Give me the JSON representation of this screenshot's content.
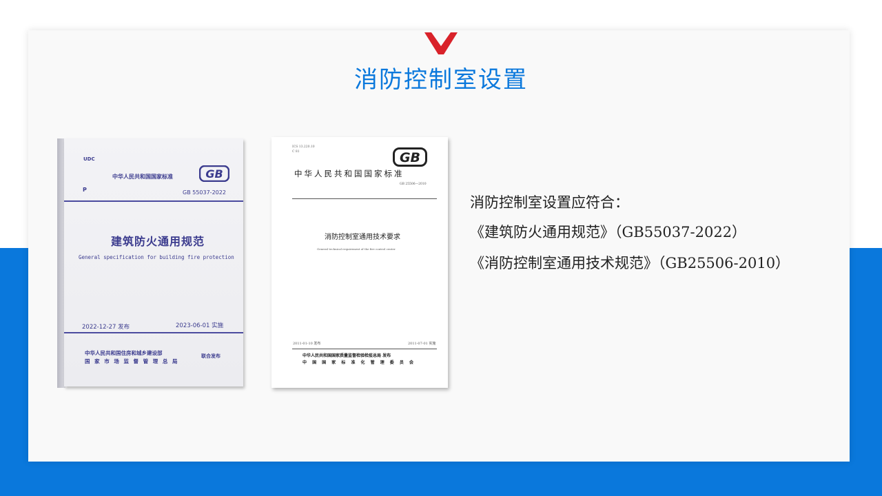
{
  "title": "消防控制室设置",
  "colors": {
    "accent": "#0a78dc",
    "logo_red": "#d9222a"
  },
  "book1": {
    "udc": "UDC",
    "standard_name": "中华人民共和国国家标准",
    "category": "P",
    "code": "GB 55037-2022",
    "title": "建筑防火通用规范",
    "english_title": "General specification for building fire protection",
    "publish_date": "2022-12-27 发布",
    "implement_date": "2023-06-01 实施",
    "dept_line1": "中华人民共和国住房和城乡建设部",
    "dept_line2": "国 家 市 场 监 督 管 理 总 局",
    "joint": "联合发布",
    "logo_text": "GB"
  },
  "book2": {
    "meta_line1": "ICS 13.220.10",
    "meta_line2": "C 81",
    "standard_name": "中华人民共和国国家标准",
    "code": "GB 25506—2010",
    "title": "消防控制室通用技术要求",
    "english_title": "General technical requirement of the fire control center",
    "publish_date": "2011-01-10 发布",
    "implement_date": "2011-07-01 实施",
    "dept_line1": "中华人民共和国国家质量监督检验检疫总局 发布",
    "dept_line2": "中 国 国 家 标 准 化 管 理 委 员 会",
    "logo_text": "GB"
  },
  "content": {
    "line1": "消防控制室设置应符合：",
    "line2": "《建筑防火通用规范》（GB55037-2022）",
    "line3": "《消防控制室通用技术规范》（GB25506-2010）"
  }
}
